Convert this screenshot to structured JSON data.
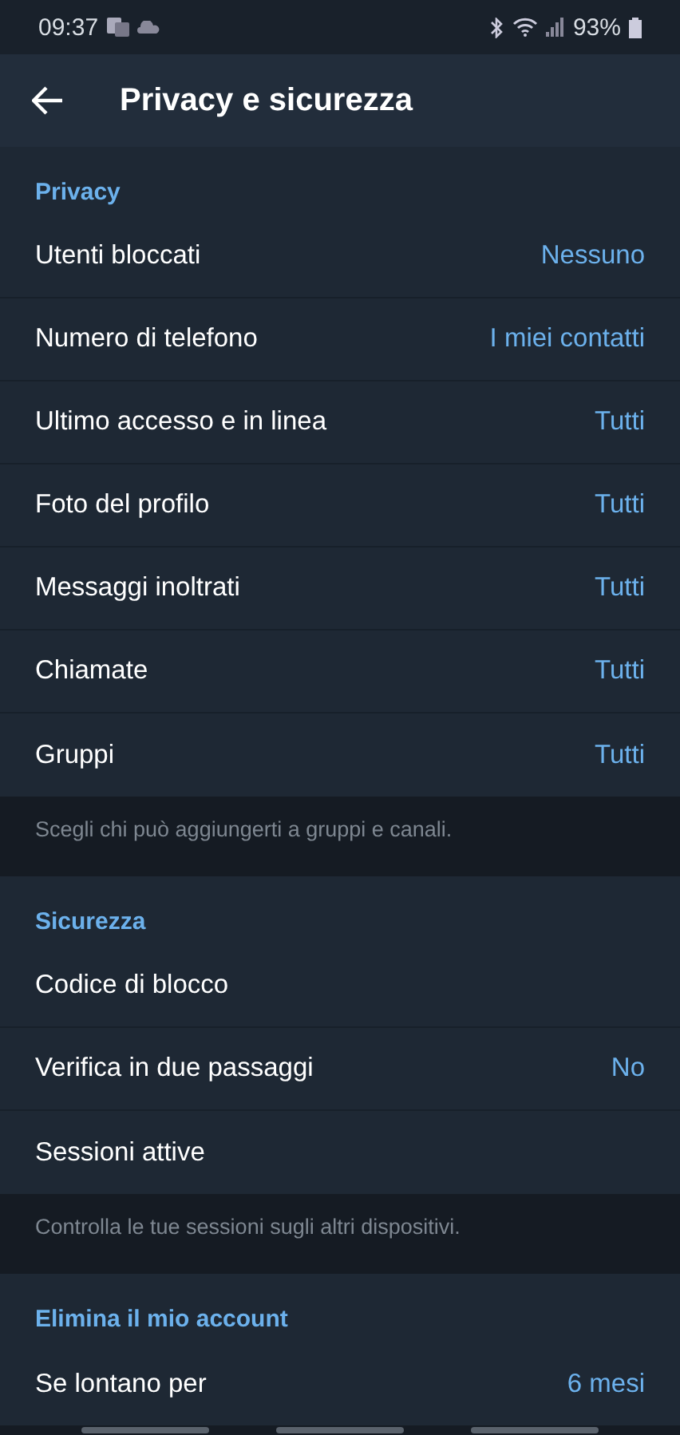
{
  "status_bar": {
    "time": "09:37",
    "battery": "93%"
  },
  "header": {
    "title": "Privacy e sicurezza"
  },
  "sections": [
    {
      "title": "Privacy",
      "rows": [
        {
          "label": "Utenti bloccati",
          "value": "Nessuno"
        },
        {
          "label": "Numero di telefono",
          "value": "I miei contatti"
        },
        {
          "label": "Ultimo accesso e in linea",
          "value": "Tutti"
        },
        {
          "label": "Foto del profilo",
          "value": "Tutti"
        },
        {
          "label": "Messaggi inoltrati",
          "value": "Tutti"
        },
        {
          "label": "Chiamate",
          "value": "Tutti"
        },
        {
          "label": "Gruppi",
          "value": "Tutti"
        }
      ],
      "footer": "Scegli chi può aggiungerti a gruppi e canali."
    },
    {
      "title": "Sicurezza",
      "rows": [
        {
          "label": "Codice di blocco"
        },
        {
          "label": "Verifica in due passaggi",
          "value": "No"
        },
        {
          "label": "Sessioni attive"
        }
      ],
      "footer": "Controlla le tue sessioni sugli altri dispositivi."
    },
    {
      "title": "Elimina il mio account",
      "rows": [
        {
          "label": "Se lontano per",
          "value": "6 mesi"
        }
      ]
    }
  ]
}
